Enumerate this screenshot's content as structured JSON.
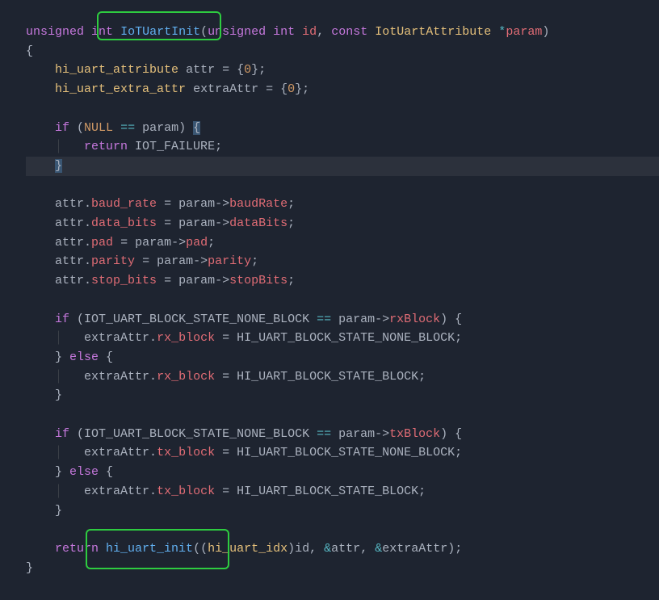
{
  "code": {
    "l1_unsigned": "unsigned",
    "l1_int": "int",
    "l1_fn": "IoTUartInit",
    "l1_lp": "(",
    "l1_unsigned2": "unsigned",
    "l1_int2": "int",
    "l1_id": "id",
    "l1_comma": ",",
    "l1_const": "const",
    "l1_cls": "IotUartAttribute",
    "l1_star": "*",
    "l1_param": "param",
    "l1_rp": ")",
    "l2_lb": "{",
    "l3_cls": "hi_uart_attribute",
    "l3_var": "attr",
    "l3_eq": " = ",
    "l3_lb": "{",
    "l3_zero": "0",
    "l3_rb": "}",
    "l3_semi": ";",
    "l4_cls": "hi_uart_extra_attr",
    "l4_var": "extraAttr",
    "l4_eq": " = ",
    "l4_lb": "{",
    "l4_zero": "0",
    "l4_rb": "}",
    "l4_semi": ";",
    "l6_if": "if",
    "l6_lp": " (",
    "l6_null": "NULL",
    "l6_eq": " == ",
    "l6_param": "param",
    "l6_rp": ") ",
    "l6_lb": "{",
    "l7_return": "return",
    "l7_const": " IOT_FAILURE",
    "l7_semi": ";",
    "l8_rb": "}",
    "l10_attr": "attr",
    "l10_dot": ".",
    "l10_prop": "baud_rate",
    "l10_eq": " = ",
    "l10_param": "param",
    "l10_arrow": "->",
    "l10_prop2": "baudRate",
    "l10_semi": ";",
    "l11_attr": "attr",
    "l11_dot": ".",
    "l11_prop": "data_bits",
    "l11_eq": " = ",
    "l11_param": "param",
    "l11_arrow": "->",
    "l11_prop2": "dataBits",
    "l11_semi": ";",
    "l12_attr": "attr",
    "l12_dot": ".",
    "l12_prop": "pad",
    "l12_eq": " = ",
    "l12_param": "param",
    "l12_arrow": "->",
    "l12_prop2": "pad",
    "l12_semi": ";",
    "l13_attr": "attr",
    "l13_dot": ".",
    "l13_prop": "parity",
    "l13_eq": " = ",
    "l13_param": "param",
    "l13_arrow": "->",
    "l13_prop2": "parity",
    "l13_semi": ";",
    "l14_attr": "attr",
    "l14_dot": ".",
    "l14_prop": "stop_bits",
    "l14_eq": " = ",
    "l14_param": "param",
    "l14_arrow": "->",
    "l14_prop2": "stopBits",
    "l14_semi": ";",
    "l16_if": "if",
    "l16_lp": " (",
    "l16_const": "IOT_UART_BLOCK_STATE_NONE_BLOCK",
    "l16_eq": " == ",
    "l16_param": "param",
    "l16_arrow": "->",
    "l16_prop": "rxBlock",
    "l16_rp": ") {",
    "l17_var": "extraAttr",
    "l17_dot": ".",
    "l17_prop": "rx_block",
    "l17_eq": " = ",
    "l17_const": "HI_UART_BLOCK_STATE_NONE_BLOCK",
    "l17_semi": ";",
    "l18_rb": "} ",
    "l18_else": "else",
    "l18_lb": " {",
    "l19_var": "extraAttr",
    "l19_dot": ".",
    "l19_prop": "rx_block",
    "l19_eq": " = ",
    "l19_const": "HI_UART_BLOCK_STATE_BLOCK",
    "l19_semi": ";",
    "l20_rb": "}",
    "l22_if": "if",
    "l22_lp": " (",
    "l22_const": "IOT_UART_BLOCK_STATE_NONE_BLOCK",
    "l22_eq": " == ",
    "l22_param": "param",
    "l22_arrow": "->",
    "l22_prop": "txBlock",
    "l22_rp": ") {",
    "l23_var": "extraAttr",
    "l23_dot": ".",
    "l23_prop": "tx_block",
    "l23_eq": " = ",
    "l23_const": "HI_UART_BLOCK_STATE_NONE_BLOCK",
    "l23_semi": ";",
    "l24_rb": "} ",
    "l24_else": "else",
    "l24_lb": " {",
    "l25_var": "extraAttr",
    "l25_dot": ".",
    "l25_prop": "tx_block",
    "l25_eq": " = ",
    "l25_const": "HI_UART_BLOCK_STATE_BLOCK",
    "l25_semi": ";",
    "l26_rb": "}",
    "l28_return": "return",
    "l28_fn": " hi_uart_init",
    "l28_lp": "((",
    "l28_cls": "hi_uart_idx",
    "l28_rp1": ")",
    "l28_id": "id",
    "l28_c1": ", ",
    "l28_amp1": "&",
    "l28_attr": "attr",
    "l28_c2": ", ",
    "l28_amp2": "&",
    "l28_extra": "extraAttr",
    "l28_rp2": ")",
    "l28_semi": ";",
    "l29_rb": "}"
  }
}
